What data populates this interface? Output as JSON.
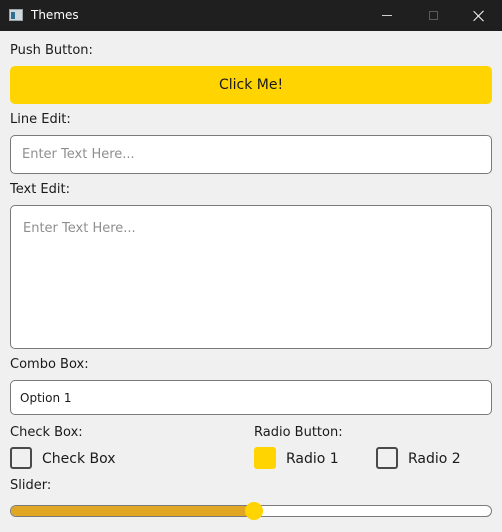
{
  "window": {
    "title": "Themes",
    "icon": "app-window-icon"
  },
  "push_button": {
    "label": "Push Button:",
    "text": "Click Me!"
  },
  "line_edit": {
    "label": "Line Edit:",
    "placeholder": "Enter Text Here..."
  },
  "text_edit": {
    "label": "Text Edit:",
    "placeholder": "Enter Text Here..."
  },
  "combo_box": {
    "label": "Combo Box:",
    "selected": "Option 1"
  },
  "check_box": {
    "label": "Check Box:",
    "option_label": "Check Box",
    "checked": false
  },
  "radio_button": {
    "label": "Radio Button:",
    "options": [
      {
        "label": "Radio 1",
        "selected": true
      },
      {
        "label": "Radio 2",
        "selected": false
      }
    ]
  },
  "slider": {
    "label": "Slider:",
    "value_fraction": 0.5
  },
  "colors": {
    "accent": "#ffd400",
    "slider_fill": "#e0a624",
    "titlebar": "#1f1f1f",
    "background": "#f0f0f0"
  }
}
